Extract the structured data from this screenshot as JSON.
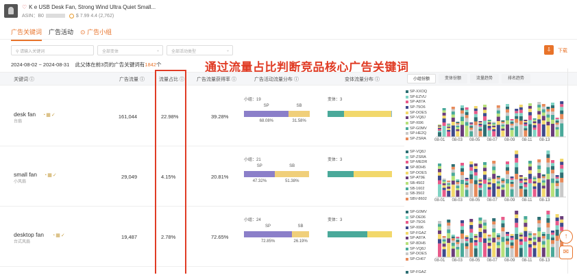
{
  "header": {
    "product_title": "K      e USB Desk Fan, Strong Wind Ultra Quiet Small...",
    "asin_label": "ASIN：",
    "asin_value": "B0",
    "price_rating": "$ 7.99  4.4 (2,762)"
  },
  "tabs": [
    {
      "label": "广告关键词",
      "active": true
    },
    {
      "label": "广告活动",
      "active": false
    },
    {
      "label": "⊙ 广告小组",
      "active": false
    }
  ],
  "filters": {
    "search_placeholder": "请输入关键词",
    "variant_placeholder": "全部变体",
    "campaign_type_placeholder": "全部活动类型",
    "download_label": "下载"
  },
  "summary": {
    "date_range": "2024-08-02 ~ 2024-08-31",
    "text_before": "此父体在前3页的广告关键词有",
    "count": "1842",
    "text_after": "个"
  },
  "annotation": "通过流量占比判断竞品核心广告关键词",
  "columns": {
    "keyword": "关键词 ⓘ",
    "ad_traffic": "广告流量 ⓘ",
    "traffic_share": "流量占比 ⓘ",
    "ad_traffic_rate": "广告流量获得率 ⓘ",
    "campaign_dist": "广告活动流量分布 ⓘ",
    "variant_dist": "变体流量分布 ⓘ"
  },
  "panel_tabs": [
    "小组份额",
    "变体份额",
    "流量趋势",
    "排名趋势"
  ],
  "colors": {
    "accent": "#e8732a",
    "annotation_red": "#e03b24",
    "sp": "#8b7fc9",
    "sb": "#f0cf7a",
    "teal": "#4aa99a",
    "yellow": "#f2d86b"
  },
  "rows": [
    {
      "keyword": "desk fan",
      "keyword_cn": "台扇",
      "ad_traffic": "161,044",
      "traffic_share": "22.98%",
      "ad_traffic_rate": "39.28%",
      "groups_label": "小组：",
      "groups": "19",
      "sp_label": "SP",
      "sb_label": "SB",
      "sp_pct": "68.08%",
      "sb_pct": "31.58%",
      "sp_value": 68.08,
      "sb_value": 31.58,
      "variants_label": "变体：",
      "variants": "3",
      "variant_split": [
        0.26,
        0.73,
        0.01
      ],
      "legend": [
        "SP-XXOQ",
        "SP-EZVU",
        "SP-A87A",
        "SP-75O6",
        "SP-DOES",
        "SP-VQ8J",
        "SP-I696",
        "SP-G0MV",
        "SP-HE2Q",
        "SP-ZSRA"
      ],
      "xticks": [
        "08-01",
        "08-03",
        "08-05",
        "08-07",
        "08-09",
        "08-11",
        "08-13"
      ]
    },
    {
      "keyword": "small fan",
      "keyword_cn": "小风扇",
      "ad_traffic": "29,049",
      "traffic_share": "4.15%",
      "ad_traffic_rate": "20.81%",
      "groups_label": "小组：",
      "groups": "21",
      "sp_label": "SP",
      "sb_label": "SB",
      "sp_pct": "47.32%",
      "sb_pct": "51.38%",
      "sp_value": 47.32,
      "sb_value": 51.38,
      "variants_label": "变体：",
      "variants": "3",
      "variant_split": [
        0.4,
        0.6,
        0
      ],
      "legend": [
        "SP-VQ8J",
        "SP-ZSRA",
        "SP-MEDR",
        "SP-8DH5",
        "SP-DOES",
        "SP-AT9E",
        "SB-4502",
        "SB-1602",
        "SB-3502",
        "SBV-8602"
      ],
      "xticks": [
        "08-01",
        "08-03",
        "08-05",
        "08-07",
        "08-09",
        "08-11",
        "08-13"
      ]
    },
    {
      "keyword": "desktop fan",
      "keyword_cn": "台式风扇",
      "ad_traffic": "19,487",
      "traffic_share": "2.78%",
      "ad_traffic_rate": "72.65%",
      "groups_label": "小组：",
      "groups": "24",
      "sp_label": "SP",
      "sb_label": "SB",
      "sp_pct": "72.85%",
      "sb_pct": "26.19%",
      "sp_value": 72.85,
      "sb_value": 26.19,
      "variants_label": "变体：",
      "variants": "3",
      "variant_split": [
        0.62,
        0.38,
        0
      ],
      "legend": [
        "SP-G0MV",
        "SP-DE06",
        "SP-75O6",
        "SP-I696",
        "SP-FGAZ",
        "SP-A87A",
        "SP-8DH5",
        "SP-VQ8J",
        "SP-DOES",
        "SP-CH67"
      ],
      "xticks": [
        "08-01",
        "08-03",
        "08-05",
        "08-07",
        "08-09",
        "08-11",
        "08-13"
      ]
    }
  ],
  "next_row_legend_first": "SP-FGAZ"
}
